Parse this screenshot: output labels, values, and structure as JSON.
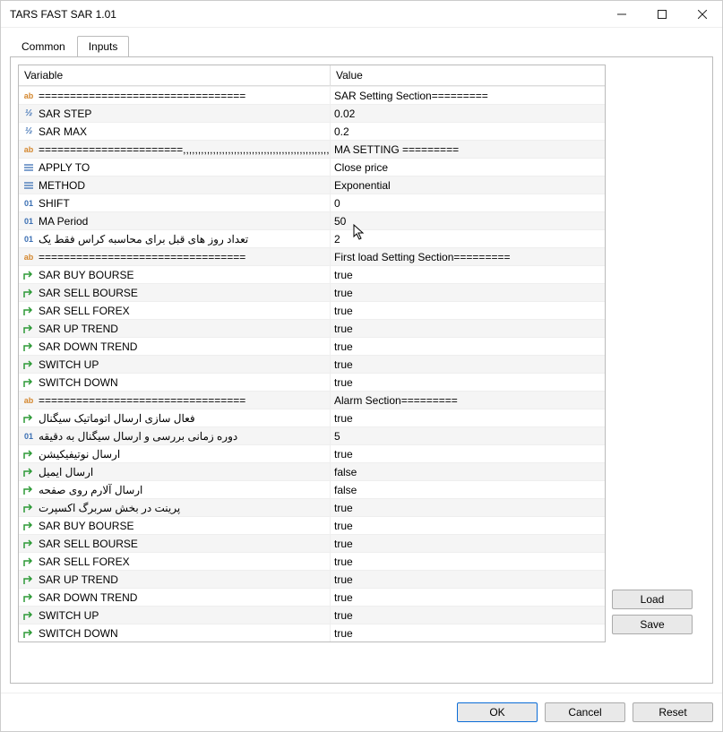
{
  "window": {
    "title": "TARS FAST SAR 1.01"
  },
  "tabs": {
    "common": "Common",
    "inputs": "Inputs",
    "active": "inputs"
  },
  "columns": {
    "variable": "Variable",
    "value": "Value"
  },
  "rows": [
    {
      "type": "ab",
      "var": "=================================",
      "val": "SAR Setting Section========="
    },
    {
      "type": "half",
      "var": "SAR STEP",
      "val": "0.02"
    },
    {
      "type": "half",
      "var": "SAR MAX",
      "val": "0.2"
    },
    {
      "type": "ab",
      "var": "=======================,,,,,,,,,,,,,,,,,,,,,,,,,,,,,,,,,,,,,,,,,,,,,,,,,,,,,,,,..",
      "val": "MA SETTING ========="
    },
    {
      "type": "enum",
      "var": "APPLY TO",
      "val": "Close price"
    },
    {
      "type": "enum",
      "var": "METHOD",
      "val": "Exponential"
    },
    {
      "type": "01",
      "var": "SHIFT",
      "val": "0"
    },
    {
      "type": "01",
      "var": "MA  Period",
      "val": "50"
    },
    {
      "type": "01",
      "var": "تعداد روز های قبل برای محاسبه کراس فقط یک",
      "val": "2"
    },
    {
      "type": "ab",
      "var": "=================================",
      "val": "First load Setting Section========="
    },
    {
      "type": "bool",
      "var": "SAR BUY BOURSE",
      "val": "true"
    },
    {
      "type": "bool",
      "var": "SAR SELL BOURSE",
      "val": "true"
    },
    {
      "type": "bool",
      "var": "SAR SELL FOREX",
      "val": "true"
    },
    {
      "type": "bool",
      "var": "SAR UP TREND",
      "val": "true"
    },
    {
      "type": "bool",
      "var": "SAR DOWN TREND",
      "val": "true"
    },
    {
      "type": "bool",
      "var": "SWITCH UP",
      "val": "true"
    },
    {
      "type": "bool",
      "var": "SWITCH DOWN",
      "val": "true"
    },
    {
      "type": "ab",
      "var": "=================================",
      "val": "Alarm Section========="
    },
    {
      "type": "bool",
      "var": "فعال سازی ارسال اتوماتیک سیگنال",
      "val": "true"
    },
    {
      "type": "01",
      "var": "دوره زمانی بررسی و ارسال سیگنال به دقیقه",
      "val": "5"
    },
    {
      "type": "bool",
      "var": "ارسال نوتیفیکیشن",
      "val": "true"
    },
    {
      "type": "bool",
      "var": "ارسال ایمیل",
      "val": "false"
    },
    {
      "type": "bool",
      "var": "ارسال آلارم روی صفحه",
      "val": "false"
    },
    {
      "type": "bool",
      "var": "پرینت در بخش سربرگ اکسپرت",
      "val": "true"
    },
    {
      "type": "bool",
      "var": "SAR BUY BOURSE",
      "val": "true"
    },
    {
      "type": "bool",
      "var": "SAR SELL BOURSE",
      "val": "true"
    },
    {
      "type": "bool",
      "var": "SAR SELL FOREX",
      "val": "true"
    },
    {
      "type": "bool",
      "var": "SAR UP TREND",
      "val": "true"
    },
    {
      "type": "bool",
      "var": "SAR DOWN TREND",
      "val": "true"
    },
    {
      "type": "bool",
      "var": "SWITCH UP",
      "val": "true"
    },
    {
      "type": "bool",
      "var": "SWITCH DOWN",
      "val": "true"
    }
  ],
  "icons": {
    "ab": "ab",
    "half": "½",
    "enum": "≡",
    "01": "01",
    "bool": "↱"
  },
  "buttons": {
    "load": "Load",
    "save": "Save",
    "ok": "OK",
    "cancel": "Cancel",
    "reset": "Reset"
  }
}
